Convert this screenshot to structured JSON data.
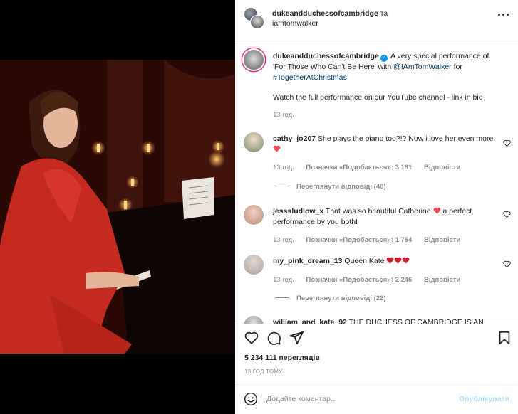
{
  "header": {
    "user1": "dukeandduchessofcambridge",
    "conj": "та",
    "user2": "iamtomwalker"
  },
  "caption": {
    "username": "dukeandduchessofcambridge",
    "text_a": " A very special performance of 'For Those Who Can't Be Here' with ",
    "mention": "@IAmTomWalker",
    "text_b": " for ",
    "hashtag": "#TogetherAtChristmas",
    "line2": "Watch the full performance on our YouTube channel - link in bio",
    "time": "13 год."
  },
  "comments": [
    {
      "username": "cathy_jo207",
      "text": " She plays the piano too?!? Now i love her even more ",
      "time": "13 год.",
      "likes": "Позначки «Подобається»: 3 181",
      "reply": "Відповісти",
      "view_replies": "Переглянути відповіді (40)"
    },
    {
      "username": "jesssludlow_x",
      "text_a": " That was so beautiful Catherine ",
      "text_b": " a perfect performance by you both!",
      "time": "13 год.",
      "likes": "Позначки «Подобається»: 1 754",
      "reply": "Відповісти"
    },
    {
      "username": "my_pink_dream_13",
      "text": " Queen Kate ",
      "time": "13 год.",
      "likes": "Позначки «Подобається»: 2 246",
      "reply": "Відповісти",
      "view_replies": "Переглянути відповіді (22)"
    },
    {
      "username": "william_and_kate_92",
      "text": " THE DUCHESS OF CAMBRIDGE IS AN"
    }
  ],
  "stats": {
    "views": "5 234 111 переглядів",
    "time": "13 ГОД ТОМУ"
  },
  "comment_box": {
    "placeholder": "Додайте коментар...",
    "post_label": "Опублікувати"
  },
  "colors": {
    "heart": "#ed4956",
    "link": "#00376b",
    "verified": "#0095f6",
    "post_disabled": "#b2dffc"
  }
}
